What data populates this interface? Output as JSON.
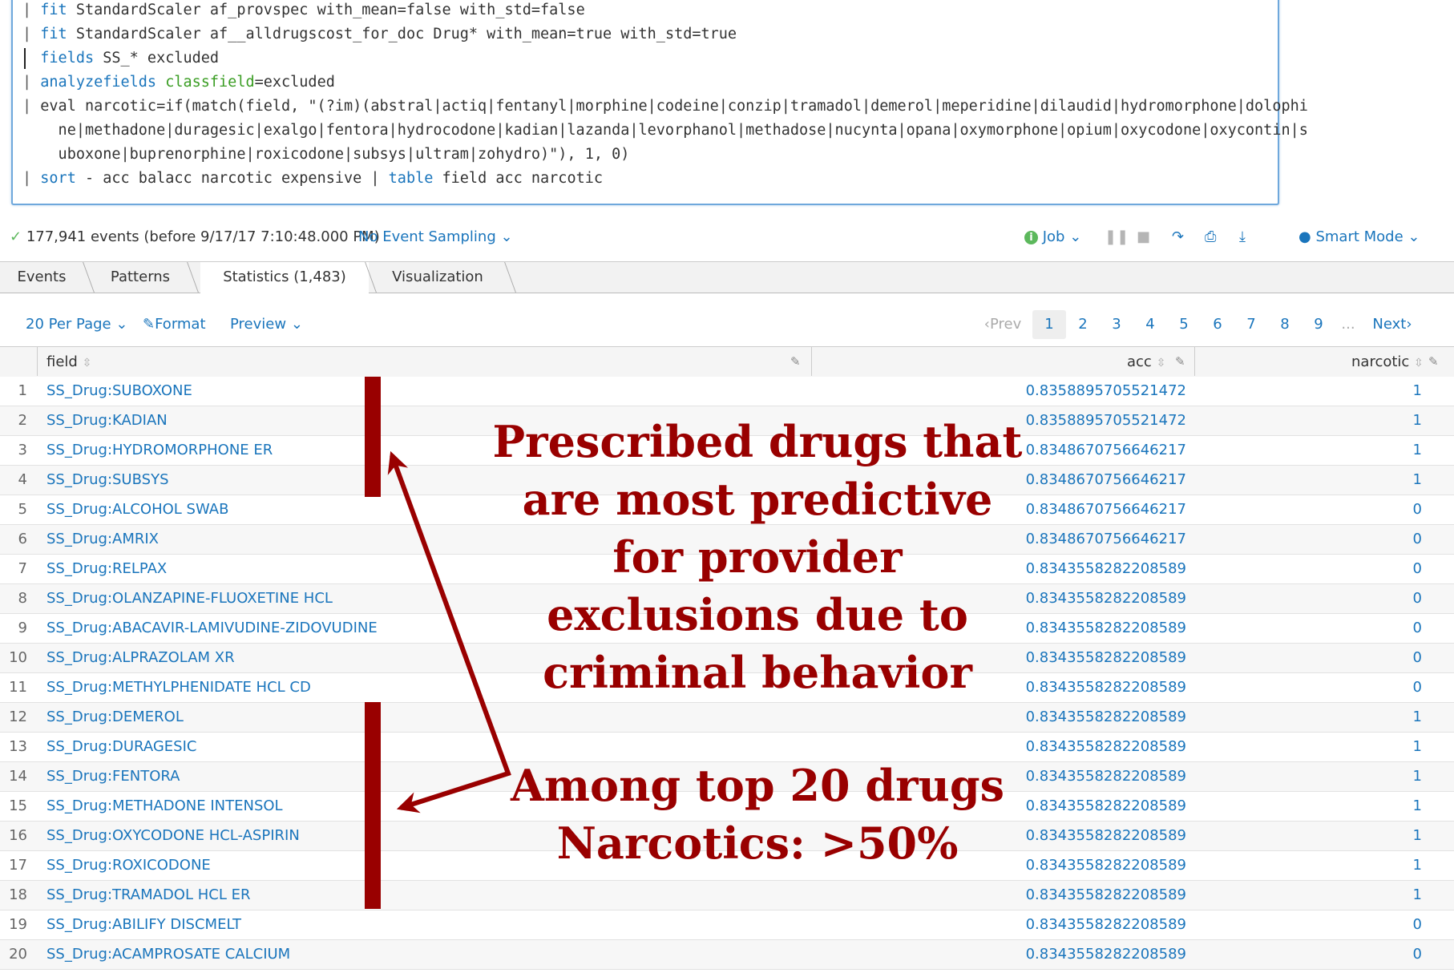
{
  "search": {
    "lines": [
      {
        "pipe": "| ",
        "kw": "fit",
        "rest": " StandardScaler af_provspec with_mean=false with_std=false"
      },
      {
        "pipe": "| ",
        "kw": "fit",
        "rest": " StandardScaler af__alldrugscost_for_doc Drug* with_mean=true with_std=true"
      },
      {
        "pipe": "  ",
        "kw": "fields",
        "rest": " SS_* excluded"
      },
      {
        "pipe": "| ",
        "kw": "analyzefields",
        "arg": " classfield",
        "rest": "=excluded"
      },
      {
        "pipe": "| ",
        "kw": "",
        "rest": "eval narcotic=if(match(field, \"(?im)(abstral|actiq|fentanyl|morphine|codeine|conzip|tramadol|demerol|meperidine|dilaudid|hydromorphone|dolophi"
      },
      {
        "pipe": "  ",
        "kw": "",
        "rest": "  ne|methadone|duragesic|exalgo|fentora|hydrocodone|kadian|lazanda|levorphanol|methadose|nucynta|opana|oxymorphone|opium|oxycodone|oxycontin|s"
      },
      {
        "pipe": "  ",
        "kw": "",
        "rest": "  uboxone|buprenorphine|roxicodone|subsys|ultram|zohydro)\"), 1, 0)"
      },
      {
        "pipe": "| ",
        "kw": "sort",
        "rest": " - acc balacc narcotic expensive | ",
        "kw2": "table",
        "rest2": " field acc narcotic"
      }
    ]
  },
  "job": {
    "status_check": "✓",
    "events_text": "177,941 events (before 9/17/17 7:10:48.000 PM)",
    "sampling_label": "No Event Sampling",
    "job_label": "Job",
    "mode_label": "Smart Mode"
  },
  "tabs": [
    "Events",
    "Patterns",
    "Statistics (1,483)",
    "Visualization"
  ],
  "controls": {
    "per_page": "20 Per Page",
    "format": "Format",
    "preview": "Preview",
    "prev": "Prev",
    "next": "Next",
    "pages": [
      "1",
      "2",
      "3",
      "4",
      "5",
      "6",
      "7",
      "8",
      "9"
    ],
    "ellipsis": "...",
    "current_page": "1"
  },
  "table": {
    "columns": [
      "field",
      "acc",
      "narcotic"
    ],
    "rows": [
      [
        "1",
        "SS_Drug:SUBOXONE",
        "0.8358895705521472",
        "1"
      ],
      [
        "2",
        "SS_Drug:KADIAN",
        "0.8358895705521472",
        "1"
      ],
      [
        "3",
        "SS_Drug:HYDROMORPHONE ER",
        "0.8348670756646217",
        "1"
      ],
      [
        "4",
        "SS_Drug:SUBSYS",
        "0.8348670756646217",
        "1"
      ],
      [
        "5",
        "SS_Drug:ALCOHOL SWAB",
        "0.8348670756646217",
        "0"
      ],
      [
        "6",
        "SS_Drug:AMRIX",
        "0.8348670756646217",
        "0"
      ],
      [
        "7",
        "SS_Drug:RELPAX",
        "0.8343558282208589",
        "0"
      ],
      [
        "8",
        "SS_Drug:OLANZAPINE-FLUOXETINE HCL",
        "0.8343558282208589",
        "0"
      ],
      [
        "9",
        "SS_Drug:ABACAVIR-LAMIVUDINE-ZIDOVUDINE",
        "0.8343558282208589",
        "0"
      ],
      [
        "10",
        "SS_Drug:ALPRAZOLAM XR",
        "0.8343558282208589",
        "0"
      ],
      [
        "11",
        "SS_Drug:METHYLPHENIDATE HCL CD",
        "0.8343558282208589",
        "0"
      ],
      [
        "12",
        "SS_Drug:DEMEROL",
        "0.8343558282208589",
        "1"
      ],
      [
        "13",
        "SS_Drug:DURAGESIC",
        "0.8343558282208589",
        "1"
      ],
      [
        "14",
        "SS_Drug:FENTORA",
        "0.8343558282208589",
        "1"
      ],
      [
        "15",
        "SS_Drug:METHADONE INTENSOL",
        "0.8343558282208589",
        "1"
      ],
      [
        "16",
        "SS_Drug:OXYCODONE HCL-ASPIRIN",
        "0.8343558282208589",
        "1"
      ],
      [
        "17",
        "SS_Drug:ROXICODONE",
        "0.8343558282208589",
        "1"
      ],
      [
        "18",
        "SS_Drug:TRAMADOL HCL ER",
        "0.8343558282208589",
        "1"
      ],
      [
        "19",
        "SS_Drug:ABILIFY DISCMELT",
        "0.8343558282208589",
        "0"
      ],
      [
        "20",
        "SS_Drug:ACAMPROSATE CALCIUM",
        "0.8343558282208589",
        "0"
      ]
    ]
  },
  "annotation": {
    "color": "#990000",
    "top_text": [
      "Prescribed drugs that",
      "are most predictive",
      "for provider",
      "exclusions due to",
      "criminal behavior"
    ],
    "bottom_text": [
      "Among top 20 drugs",
      "Narcotics: >50%"
    ]
  }
}
